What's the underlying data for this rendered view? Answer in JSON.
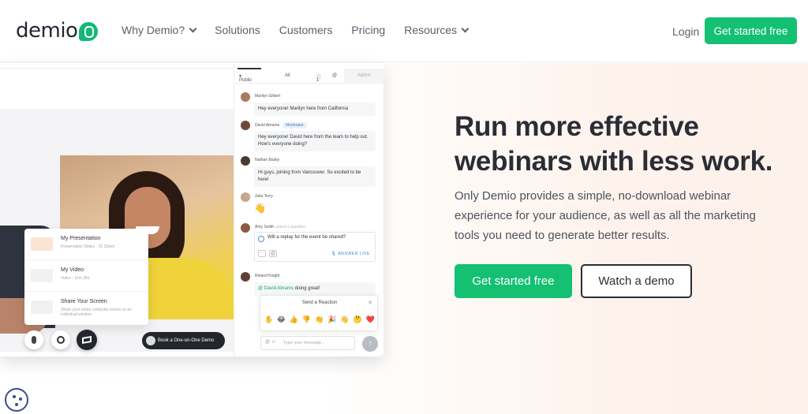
{
  "nav": {
    "logo_text": "demio",
    "menu": [
      {
        "label": "Why Demio?",
        "dropdown": true
      },
      {
        "label": "Solutions",
        "dropdown": false
      },
      {
        "label": "Customers",
        "dropdown": false
      },
      {
        "label": "Pricing",
        "dropdown": false
      },
      {
        "label": "Resources",
        "dropdown": true
      }
    ],
    "login": "Login",
    "cta": "Get started free"
  },
  "hero": {
    "title": "Run more effective webinars with less work.",
    "subtitle": "Only Demio provides a simple, no-download webinar experience for your audience, as well as all the marketing tools you need to generate better results.",
    "primary_cta": "Get started free",
    "secondary_cta": "Watch a demo"
  },
  "mockup": {
    "share_menu": [
      {
        "title": "My Presentation",
        "desc": "Presentation Slides - 32 Slides"
      },
      {
        "title": "My Video",
        "desc": "Video - 12m 39s"
      },
      {
        "title": "Share Your Screen",
        "desc": "Share your entire computer screen or an individual window"
      }
    ],
    "book_demo": "Book a One-on-One Demo",
    "chat": {
      "tab_public": "Public",
      "tab_all": "All",
      "tab_count": "1",
      "tab_admin": "Admin",
      "messages": [
        {
          "name": "Marilyn Gilbert",
          "text": "Hey everyone! Marilyn here from California"
        },
        {
          "name": "David Abrams",
          "badge": "Moderator",
          "text": "Hey everyone! David here from the team to help out. How's everyone doing?"
        },
        {
          "name": "Nathan Bailey",
          "text": "Hi guys, joining from Vancouver. So excited to be here!"
        },
        {
          "name": "Julia Terry",
          "text": "👋"
        },
        {
          "name": "Amy Smith",
          "asked": "asked a question",
          "text": "Will a replay for the event be shared?",
          "answer": "ANSWER LIVE"
        },
        {
          "name": "Roland Knight",
          "mention": "@ David Abrams",
          "text": "doing great!"
        }
      ],
      "reaction_title": "Send a Reaction",
      "reactions": [
        "✋",
        "😂",
        "👍",
        "👎",
        "👏",
        "🎉",
        "👋",
        "🤔",
        "❤️"
      ],
      "input_placeholder": "Type your message..."
    }
  },
  "colors": {
    "brand_green": "#14c072",
    "dark_text": "#2a2d35"
  }
}
